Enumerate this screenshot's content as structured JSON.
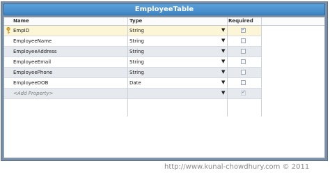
{
  "title": "EmployeeTable",
  "columns": {
    "name": "Name",
    "type": "Type",
    "required": "Required"
  },
  "rows": [
    {
      "name": "EmpID",
      "type": "String",
      "required": true,
      "key": true
    },
    {
      "name": "EmployeeName",
      "type": "String",
      "required": false
    },
    {
      "name": "EmployeeAddress",
      "type": "String",
      "required": false
    },
    {
      "name": "EmployeeEmail",
      "type": "String",
      "required": false
    },
    {
      "name": "EmployeePhone",
      "type": "String",
      "required": false
    },
    {
      "name": "EmployeeDOB",
      "type": "Date",
      "required": false
    }
  ],
  "add_row": {
    "name": "<Add Property>",
    "type": "",
    "required": false
  },
  "watermark": "http://www.kunal-chowdhury.com © 2011",
  "icons": {
    "key": "key-icon",
    "dropdown": "chevron-down-icon",
    "checkbox": "checkbox-icon"
  }
}
